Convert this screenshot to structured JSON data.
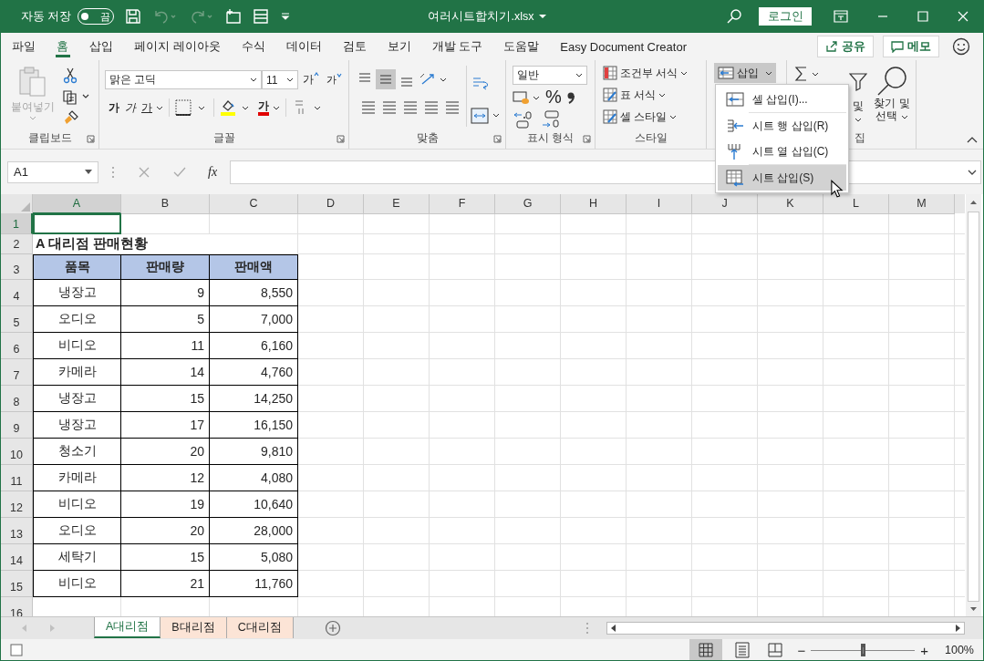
{
  "title_bar": {
    "autosave_label": "자동 저장",
    "autosave": {
      "on": false,
      "text": "끔"
    },
    "undo": {
      "disabled": true
    },
    "redo": {
      "disabled": true
    },
    "filename": "여러시트합치기.xlsx",
    "login": "로그인"
  },
  "menu_tabs": [
    {
      "label": "파일",
      "selected": false
    },
    {
      "label": "홈",
      "selected": true
    },
    {
      "label": "삽입",
      "selected": false
    },
    {
      "label": "페이지 레이아웃",
      "selected": false
    },
    {
      "label": "수식",
      "selected": false
    },
    {
      "label": "데이터",
      "selected": false
    },
    {
      "label": "검토",
      "selected": false
    },
    {
      "label": "보기",
      "selected": false
    },
    {
      "label": "개발 도구",
      "selected": false
    },
    {
      "label": "도움말",
      "selected": false
    },
    {
      "label": "Easy Document Creator",
      "selected": false
    }
  ],
  "share": "공유",
  "comments": "메모",
  "ribbon": {
    "clipboard": {
      "paste": "붙여넣기",
      "label": "클립보드"
    },
    "font": {
      "name": "맑은 고딕",
      "size": "11",
      "grow": "가",
      "shrink": "가",
      "bold": "가",
      "italic": "가",
      "underline": "가",
      "color_letter": "가",
      "label": "글꼴"
    },
    "alignment": {
      "label": "맞춤"
    },
    "number": {
      "format": "일반",
      "percent": "%",
      "label": "표시 형식"
    },
    "styles": {
      "items": [
        "조건부 서식",
        "표 서식",
        "셀 스타일"
      ],
      "label": "스타일"
    },
    "cells": {
      "insert": "삽입",
      "expanded": true
    },
    "editing": {
      "sort_text": "및",
      "find_lines": [
        "찾기 및",
        "선택"
      ],
      "label": "집"
    }
  },
  "insert_menu": [
    {
      "label": "셀 삽입(I)...",
      "kind": "cell",
      "selected": false
    },
    {
      "label": "시트 행 삽입(R)",
      "kind": "row",
      "selected": false
    },
    {
      "label": "시트 열 삽입(C)",
      "kind": "column",
      "selected": false
    },
    {
      "label": "시트 삽입(S)",
      "kind": "sheet",
      "selected": true
    }
  ],
  "formula_bar": {
    "name_box": "A1",
    "fx": "fx"
  },
  "sheet": {
    "columns": [
      {
        "label": "A",
        "selected": true
      },
      {
        "label": "B",
        "selected": false
      },
      {
        "label": "C",
        "selected": false
      },
      {
        "label": "D",
        "selected": false
      },
      {
        "label": "E",
        "selected": false
      },
      {
        "label": "F",
        "selected": false
      },
      {
        "label": "G",
        "selected": false
      },
      {
        "label": "H",
        "selected": false
      },
      {
        "label": "I",
        "selected": false
      },
      {
        "label": "J",
        "selected": false
      },
      {
        "label": "K",
        "selected": false
      },
      {
        "label": "L",
        "selected": false
      },
      {
        "label": "M",
        "selected": false
      }
    ],
    "rows": [
      {
        "number": "1",
        "kind": "blank",
        "selected": true
      },
      {
        "number": "2",
        "kind": "title",
        "selected": false,
        "title": "A 대리점 판매현황"
      },
      {
        "number": "3",
        "kind": "header",
        "selected": false,
        "cells": [
          "품목",
          "판매량",
          "판매액"
        ]
      },
      {
        "number": "4",
        "kind": "data",
        "selected": false,
        "cells": [
          "냉장고",
          "9",
          "8,550"
        ]
      },
      {
        "number": "5",
        "kind": "data",
        "selected": false,
        "cells": [
          "오디오",
          "5",
          "7,000"
        ]
      },
      {
        "number": "6",
        "kind": "data",
        "selected": false,
        "cells": [
          "비디오",
          "11",
          "6,160"
        ]
      },
      {
        "number": "7",
        "kind": "data",
        "selected": false,
        "cells": [
          "카메라",
          "14",
          "4,760"
        ]
      },
      {
        "number": "8",
        "kind": "data",
        "selected": false,
        "cells": [
          "냉장고",
          "15",
          "14,250"
        ]
      },
      {
        "number": "9",
        "kind": "data",
        "selected": false,
        "cells": [
          "냉장고",
          "17",
          "16,150"
        ]
      },
      {
        "number": "10",
        "kind": "data",
        "selected": false,
        "cells": [
          "청소기",
          "20",
          "9,810"
        ]
      },
      {
        "number": "11",
        "kind": "data",
        "selected": false,
        "cells": [
          "카메라",
          "12",
          "4,080"
        ]
      },
      {
        "number": "12",
        "kind": "data",
        "selected": false,
        "cells": [
          "비디오",
          "19",
          "10,640"
        ]
      },
      {
        "number": "13",
        "kind": "data",
        "selected": false,
        "cells": [
          "오디오",
          "20",
          "28,000"
        ]
      },
      {
        "number": "14",
        "kind": "data",
        "selected": false,
        "cells": [
          "세탁기",
          "15",
          "5,080"
        ]
      },
      {
        "number": "15",
        "kind": "data",
        "selected": false,
        "cells": [
          "비디오",
          "21",
          "11,760"
        ]
      },
      {
        "number": "16",
        "kind": "blank",
        "selected": false
      }
    ]
  },
  "sheet_tabs": [
    {
      "label": "A대리점",
      "selected": true
    },
    {
      "label": "B대리점",
      "selected": false,
      "color": "#fce4d6"
    },
    {
      "label": "C대리점",
      "selected": false,
      "color": "#fce4d6"
    }
  ],
  "status_bar": {
    "zoom_out": "−",
    "zoom_in": "+",
    "zoom_slider": {
      "level": 0.5
    },
    "zoom": "100%"
  }
}
